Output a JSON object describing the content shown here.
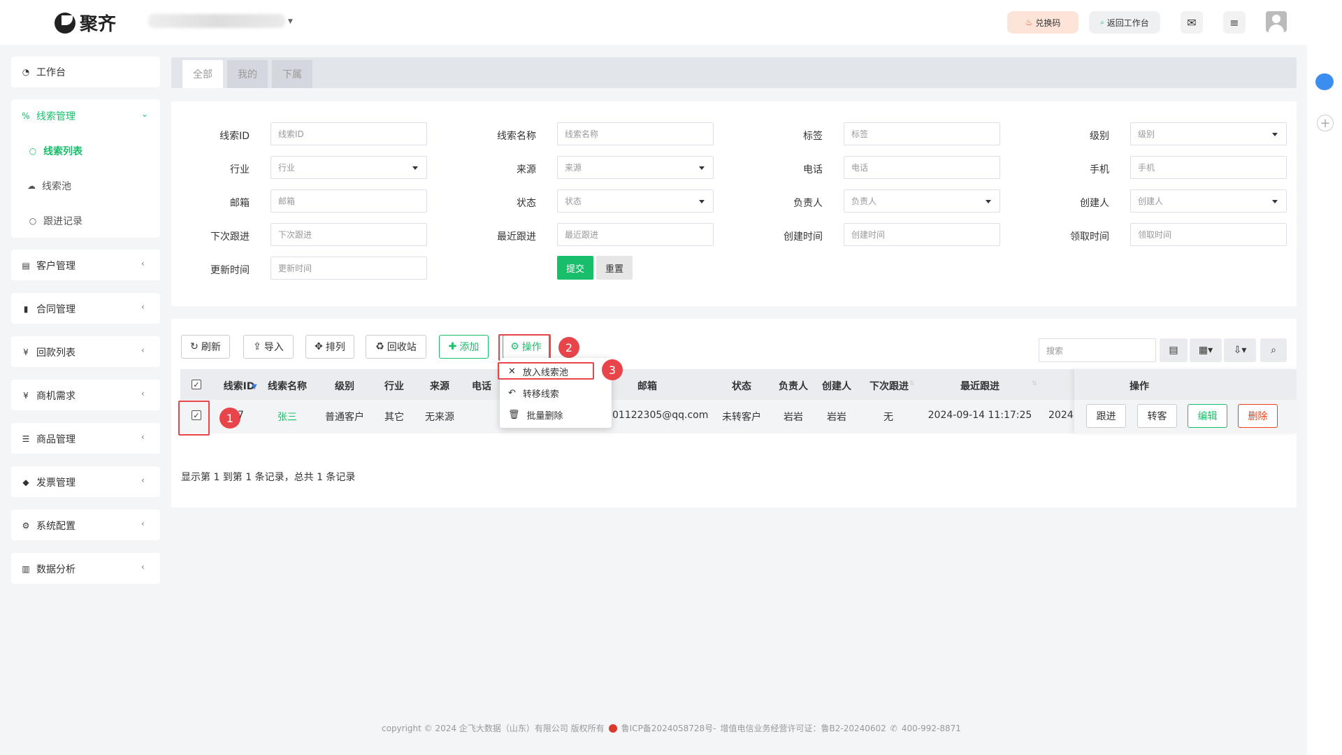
{
  "header": {
    "brand": "聚齐",
    "redeem_label": "兑换码",
    "back_label": "返回工作台"
  },
  "sidebar": {
    "workbench": "工作台",
    "lead_mgmt": "线索管理",
    "lead_list": "线索列表",
    "lead_pool": "线索池",
    "follow_records": "跟进记录",
    "groups": [
      "客户管理",
      "合同管理",
      "回款列表",
      "商机需求",
      "商品管理",
      "发票管理",
      "系统配置",
      "数据分析"
    ]
  },
  "tabs": [
    "全部",
    "我的",
    "下属"
  ],
  "filters": {
    "labels": [
      "线索ID",
      "线索名称",
      "标签",
      "级别",
      "行业",
      "来源",
      "电话",
      "手机",
      "邮箱",
      "状态",
      "负责人",
      "创建人",
      "下次跟进",
      "最近跟进",
      "创建时间",
      "领取时间",
      "更新时间"
    ],
    "placeholders": [
      "线索ID",
      "线索名称",
      "标签",
      "级别",
      "行业",
      "来源",
      "电话",
      "手机",
      "邮箱",
      "状态",
      "负责人",
      "创建人",
      "下次跟进",
      "最近跟进",
      "创建时间",
      "领取时间",
      "更新时间"
    ],
    "submit": "提交",
    "reset": "重置"
  },
  "toolbar": {
    "refresh": "刷新",
    "import": "导入",
    "sort": "排列",
    "recycle": "回收站",
    "add": "添加",
    "operate": "操作",
    "search_placeholder": "搜索"
  },
  "dropdown": {
    "put_pool": "放入线索池",
    "transfer": "转移线索",
    "batch_delete": "批量删除"
  },
  "table": {
    "headers": [
      "线索ID",
      "线索名称",
      "级别",
      "行业",
      "来源",
      "电话",
      "邮箱",
      "状态",
      "负责人",
      "创建人",
      "下次跟进",
      "最近跟进",
      "操作"
    ],
    "row": {
      "id": "7",
      "name": "张三",
      "level": "普通客户",
      "industry": "其它",
      "source": "无来源",
      "email": "01122305@qq.com",
      "status": "未转客户",
      "owner": "岩岩",
      "creator": "岩岩",
      "next_follow": "无",
      "last_follow": "2024-09-14 11:17:25",
      "created": "2024"
    },
    "actions": [
      "跟进",
      "转客",
      "编辑",
      "删除"
    ],
    "summary": "显示第 1 到第 1 条记录，总共 1 条记录"
  },
  "annotations": [
    "1",
    "2",
    "3"
  ],
  "footer": {
    "copyright": "copyright © 2024 企飞大数据（山东）有限公司 版权所有",
    "icp": "鲁ICP备2024058728号-",
    "license": "增值电信业务经营许可证：鲁B2-20240602",
    "phone": "400-992-8871"
  }
}
